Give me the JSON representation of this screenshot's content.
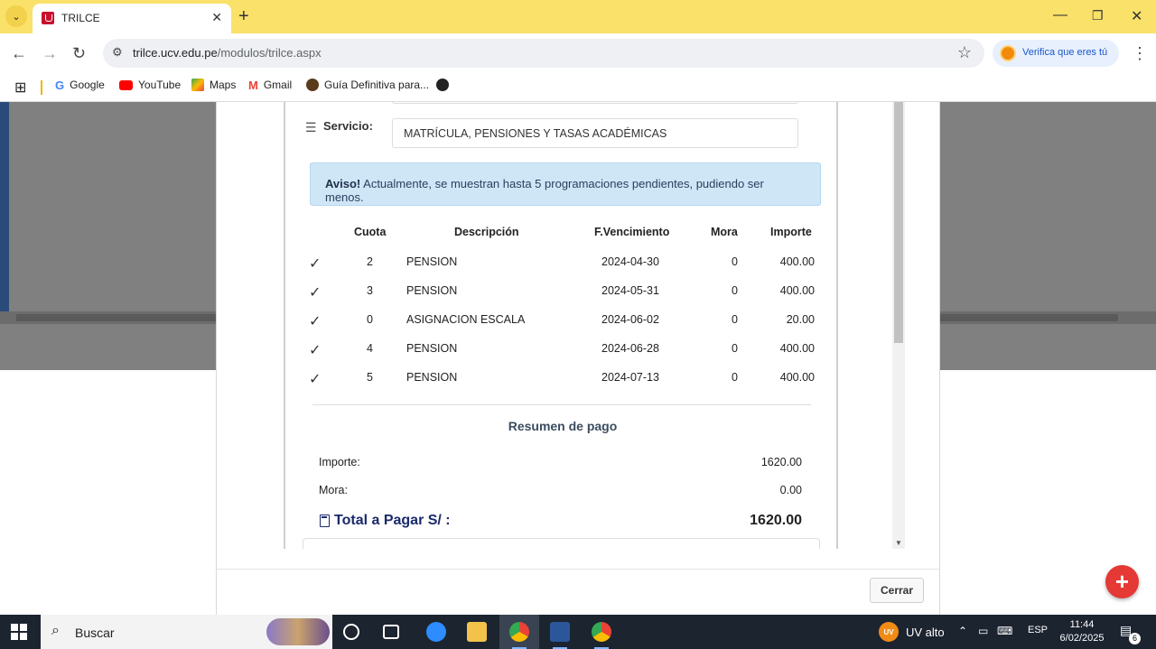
{
  "browser": {
    "tab_title": "TRILCE",
    "url_host": "trilce.ucv.edu.pe",
    "url_path": "/modulos/trilce.aspx",
    "verify_label": "Verifica que eres tú",
    "bookmarks": [
      "Google",
      "YouTube",
      "Maps",
      "Gmail",
      "Guía Definitiva para..."
    ]
  },
  "modal": {
    "service_label": "Servicio:",
    "service_value": "MATRÍCULA, PENSIONES Y TASAS ACADÉMICAS",
    "alert_strong": "Aviso!",
    "alert_text": " Actualmente, se muestran hasta 5 programaciones pendientes, pudiendo ser menos.",
    "table": {
      "headers": [
        "Cuota",
        "Descripción",
        "F.Vencimiento",
        "Mora",
        "Importe"
      ],
      "rows": [
        {
          "cuota": "2",
          "descripcion": "PENSION",
          "vencimiento": "2024-04-30",
          "mora": "0",
          "importe": "400.00"
        },
        {
          "cuota": "3",
          "descripcion": "PENSION",
          "vencimiento": "2024-05-31",
          "mora": "0",
          "importe": "400.00"
        },
        {
          "cuota": "0",
          "descripcion": "ASIGNACION ESCALA",
          "vencimiento": "2024-06-02",
          "mora": "0",
          "importe": "20.00"
        },
        {
          "cuota": "4",
          "descripcion": "PENSION",
          "vencimiento": "2024-06-28",
          "mora": "0",
          "importe": "400.00"
        },
        {
          "cuota": "5",
          "descripcion": "PENSION",
          "vencimiento": "2024-07-13",
          "mora": "0",
          "importe": "400.00"
        }
      ]
    },
    "summary_title": "Resumen de pago",
    "importe_label": "Importe:",
    "importe_value": "1620.00",
    "mora_label": "Mora:",
    "mora_value": "0.00",
    "total_label": "Total a Pagar S/ :",
    "total_value": "1620.00",
    "close_label": "Cerrar"
  },
  "taskbar": {
    "search_placeholder": "Buscar",
    "uv_label": "UV alto",
    "uv_badge": "UV",
    "lang": "ESP",
    "time": "11:44",
    "date": "6/02/2025",
    "notif_count": "6"
  },
  "colors": {
    "tabbar": "#f9e16a",
    "alert_bg": "#cfe6f7",
    "total_color": "#1a2a6b",
    "fab": "#e53935"
  }
}
